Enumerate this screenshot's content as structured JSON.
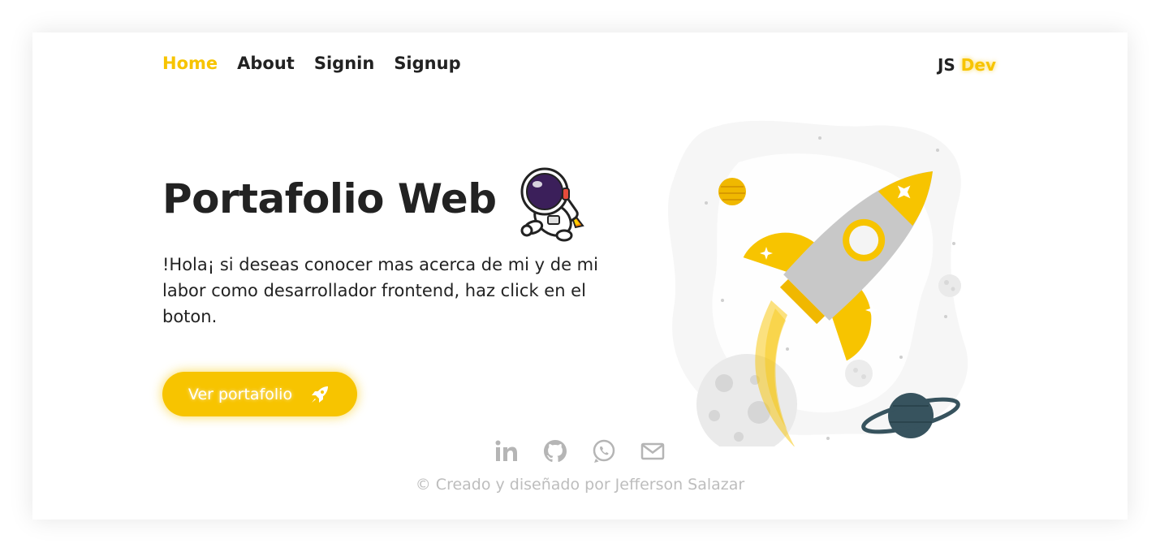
{
  "nav": {
    "items": [
      {
        "label": "Home",
        "active": true
      },
      {
        "label": "About",
        "active": false
      },
      {
        "label": "Signin",
        "active": false
      },
      {
        "label": "Signup",
        "active": false
      }
    ]
  },
  "brand": {
    "prefix": "JS",
    "accent": "Dev"
  },
  "hero": {
    "title": "Portafolio Web",
    "description": "!Hola¡ si deseas conocer mas acerca de mi y de mi labor como desarrollador frontend, haz click en el boton.",
    "cta_label": "Ver portafolio",
    "cta_icon": "rocket-icon",
    "side_image": "astronaut-illustration",
    "main_image": "rocket-space-illustration"
  },
  "social": [
    {
      "icon": "linkedin-icon"
    },
    {
      "icon": "github-icon"
    },
    {
      "icon": "whatsapp-icon"
    },
    {
      "icon": "mail-icon"
    }
  ],
  "footer": {
    "text": "© Creado y diseñado por Jefferson Salazar"
  },
  "colors": {
    "accent": "#f7c400",
    "text": "#222222",
    "muted": "#bdbdbd",
    "rocket_body": "#c8c8c8",
    "planet": "#37535e"
  }
}
